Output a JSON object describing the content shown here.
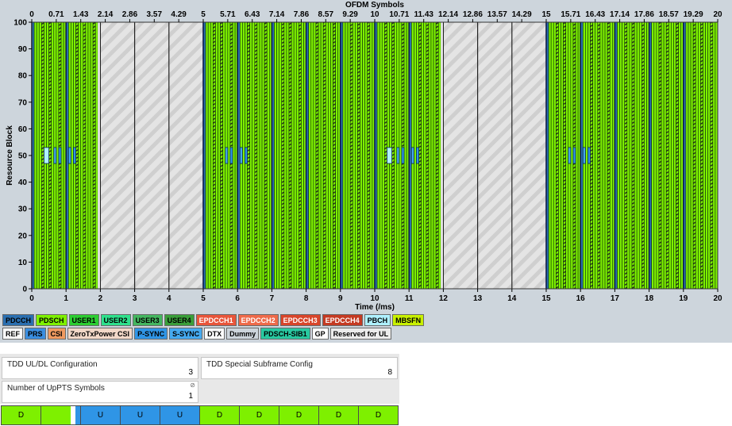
{
  "plot": {
    "top_axis_title": "OFDM Symbols",
    "y_axis_title": "Resource Block",
    "x_axis_title": "Time (/ms)",
    "top_ticks": [
      "0",
      "0.71",
      "1.43",
      "2.14",
      "2.86",
      "3.57",
      "4.29",
      "5",
      "5.71",
      "6.43",
      "7.14",
      "7.86",
      "8.57",
      "9.29",
      "10",
      "10.71",
      "11.43",
      "12.14",
      "12.86",
      "13.57",
      "14.29",
      "15",
      "15.71",
      "16.43",
      "17.14",
      "17.86",
      "18.57",
      "19.29",
      "20"
    ],
    "bottom_ticks": [
      "0",
      "1",
      "2",
      "3",
      "4",
      "5",
      "6",
      "7",
      "8",
      "9",
      "10",
      "11",
      "12",
      "13",
      "14",
      "15",
      "16",
      "17",
      "18",
      "19",
      "20"
    ],
    "y_ticks": [
      "0",
      "10",
      "20",
      "30",
      "40",
      "50",
      "60",
      "70",
      "80",
      "90",
      "100"
    ],
    "x_range": [
      0,
      20
    ],
    "y_range": [
      0,
      100
    ],
    "uplink_subframes": [
      2,
      3,
      4,
      12,
      13,
      14
    ],
    "special_subframes": [
      1,
      11
    ],
    "colors": {
      "pdsch": "#7ef000",
      "pdcch": "#2a6fb0",
      "pbch": "#aef0ff",
      "uplink_bg": "#e2e2e2",
      "uplink_hatch": "#c8c8c8",
      "panel": "#cdd5dc"
    }
  },
  "legend": {
    "row1": [
      {
        "label": "PDCCH",
        "color": "#2a6fb0",
        "text_color": "#000000"
      },
      {
        "label": "PDSCH",
        "color": "#7ef000",
        "text_color": "#000000"
      },
      {
        "label": "USER1",
        "color": "#2ccd32",
        "text_color": "#000000"
      },
      {
        "label": "USER2",
        "color": "#2ee08c",
        "text_color": "#000000"
      },
      {
        "label": "USER3",
        "color": "#44b660",
        "text_color": "#000000"
      },
      {
        "label": "USER4",
        "color": "#3a9e3a",
        "text_color": "#000000"
      },
      {
        "label": "EPDCCH1",
        "color": "#e8553a",
        "text_color": "#ffffff"
      },
      {
        "label": "EPDCCH2",
        "color": "#ee6a4a",
        "text_color": "#ffffff"
      },
      {
        "label": "EPDCCH3",
        "color": "#d8452a",
        "text_color": "#ffffff"
      },
      {
        "label": "EPDCCH4",
        "color": "#c43a22",
        "text_color": "#ffffff"
      },
      {
        "label": "PBCH",
        "color": "#aef0ff",
        "text_color": "#000000"
      },
      {
        "label": "MBSFN",
        "color": "#c8f000",
        "text_color": "#000000"
      }
    ],
    "row2": [
      {
        "label": "REF",
        "color": "#ffffff",
        "text_color": "#000000"
      },
      {
        "label": "PRS",
        "color": "#3a8ee0",
        "text_color": "#000000"
      },
      {
        "label": "CSI",
        "color": "#f09a60",
        "text_color": "#000000"
      },
      {
        "label": "ZeroTxPower CSI",
        "color": "#f2d8c8",
        "text_color": "#000000"
      },
      {
        "label": "P-SYNC",
        "color": "#2f95e6",
        "text_color": "#000000"
      },
      {
        "label": "S-SYNC",
        "color": "#45aaf0",
        "text_color": "#000000"
      },
      {
        "label": "DTX",
        "color": "#ffffff",
        "text_color": "#000000"
      },
      {
        "label": "Dummy",
        "color": "#cdd5dc",
        "text_color": "#000000"
      },
      {
        "label": "PDSCH-SIB1",
        "color": "#28c8a0",
        "text_color": "#000000"
      },
      {
        "label": "GP",
        "color": "#ffffff",
        "text_color": "#000000"
      },
      {
        "label": "Reserved for UL",
        "color": "#ececec",
        "text_color": "#000000"
      }
    ]
  },
  "config": {
    "tdd_ul_dl_label": "TDD UL/DL Configuration",
    "tdd_ul_dl_value": "3",
    "special_subframe_label": "TDD Special Subframe Config",
    "special_subframe_value": "8",
    "uppts_label": "Number of UpPTS Symbols",
    "uppts_value": "1"
  },
  "subframes": [
    {
      "type": "D",
      "label": "D"
    },
    {
      "type": "S",
      "label": ""
    },
    {
      "type": "U",
      "label": "U"
    },
    {
      "type": "U",
      "label": "U"
    },
    {
      "type": "U",
      "label": "U"
    },
    {
      "type": "D",
      "label": "D"
    },
    {
      "type": "D",
      "label": "D"
    },
    {
      "type": "D",
      "label": "D"
    },
    {
      "type": "D",
      "label": "D"
    },
    {
      "type": "D",
      "label": "D"
    }
  ]
}
